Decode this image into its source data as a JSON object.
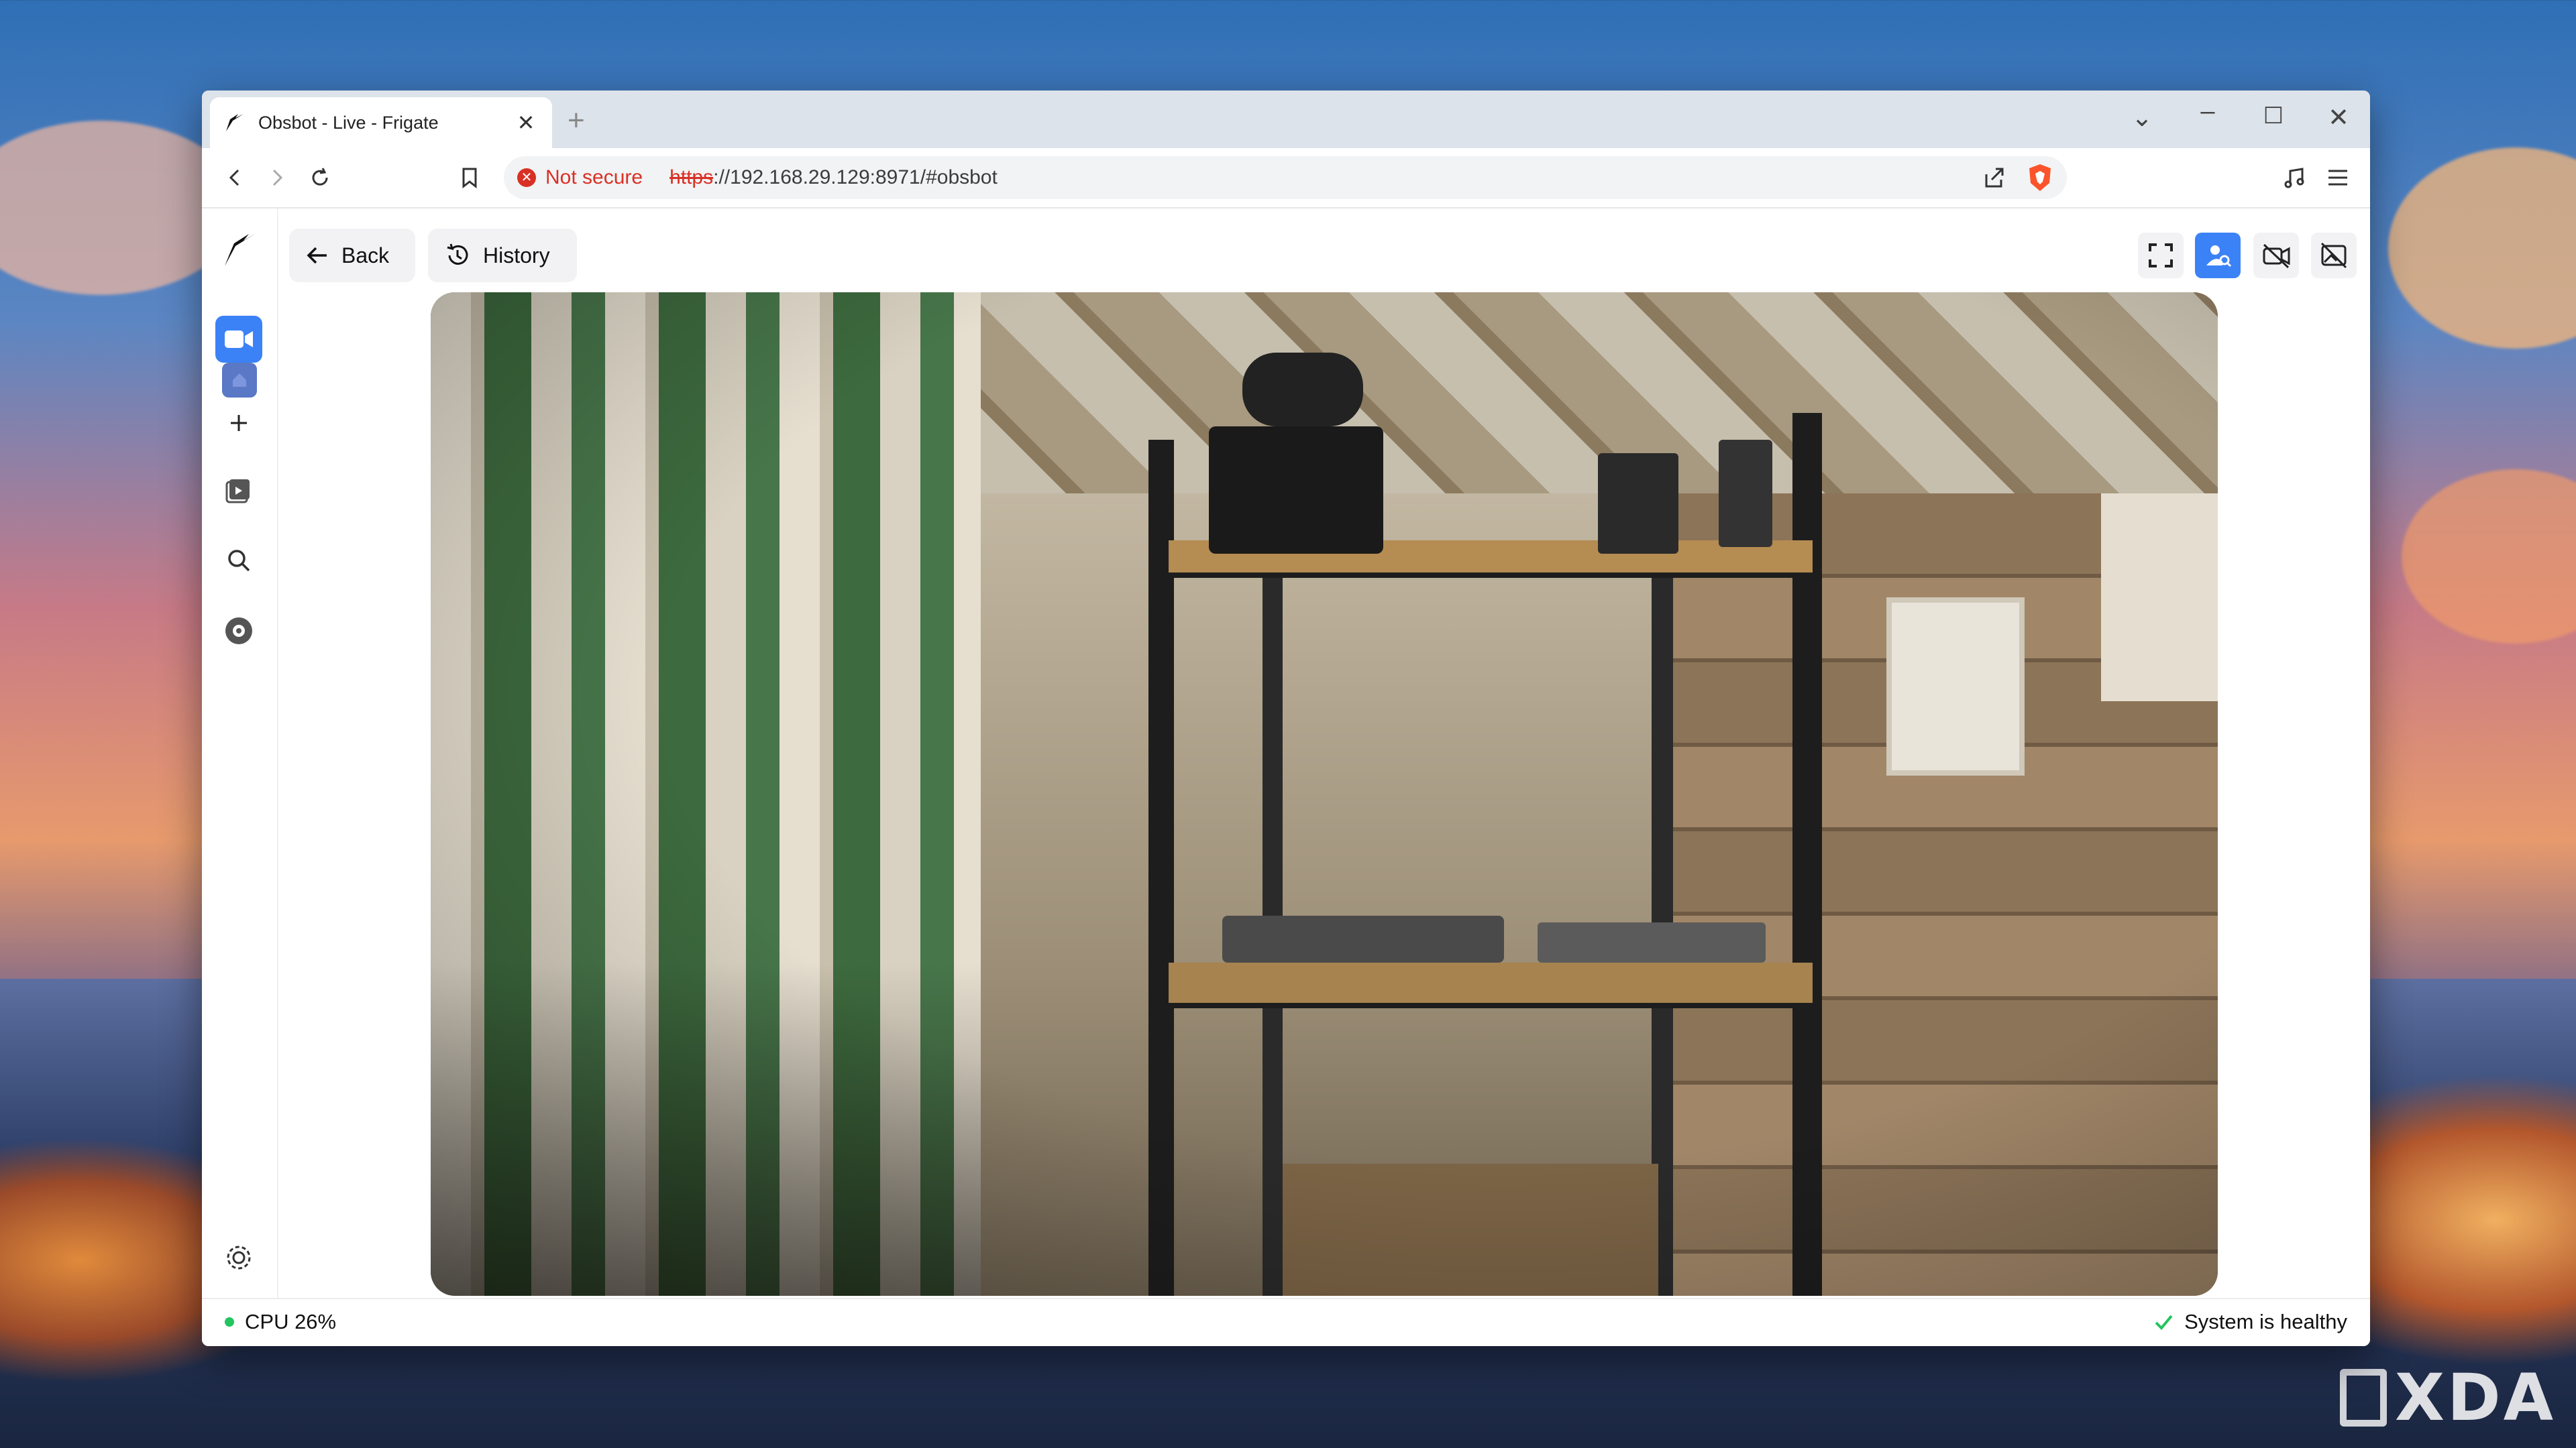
{
  "browser": {
    "tab_title": "Obsbot - Live - Frigate",
    "new_tab": "+",
    "security_label": "Not secure",
    "url_scheme": "https",
    "url_rest": "://192.168.29.129:8971/#obsbot"
  },
  "app": {
    "back_label": "Back",
    "history_label": "History"
  },
  "status": {
    "cpu": "CPU 26%",
    "health": "System is healthy"
  },
  "colors": {
    "accent": "#3b82f6",
    "ok": "#22c55e",
    "danger": "#d93025"
  },
  "watermark": "XDA"
}
